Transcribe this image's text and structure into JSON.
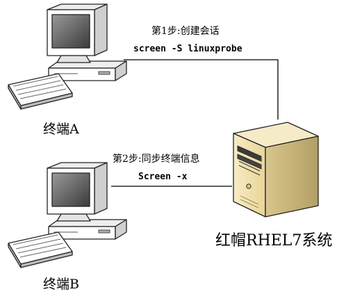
{
  "steps": [
    {
      "label": "第1步:创建会话",
      "command": "screen -S linuxprobe"
    },
    {
      "label": "第2步:同步终端信息",
      "command": "Screen -x"
    }
  ],
  "nodes": {
    "terminal_a": "终端A",
    "terminal_b": "终端B",
    "server": "红帽RHEL7系统"
  },
  "colors": {
    "line": "#000000",
    "monitor_shell": "#ffffff",
    "screen": "#5a5a5a",
    "server_body": "#f3e4b0",
    "server_side": "#c7b57a"
  }
}
